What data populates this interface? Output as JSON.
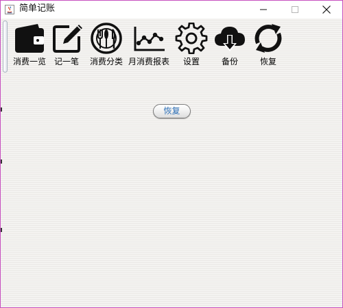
{
  "window": {
    "title": "简单记账",
    "controls": {
      "minimize": "minimize",
      "maximize": "maximize",
      "close": "close"
    }
  },
  "toolbar": {
    "items": [
      {
        "label": "消费一览",
        "icon": "wallet-icon"
      },
      {
        "label": "记一笔",
        "icon": "edit-icon"
      },
      {
        "label": "消费分类",
        "icon": "utensils-icon"
      },
      {
        "label": "月消费报表",
        "icon": "line-chart-icon"
      },
      {
        "label": "设置",
        "icon": "gear-icon"
      },
      {
        "label": "备份",
        "icon": "cloud-download-icon"
      },
      {
        "label": "恢复",
        "icon": "refresh-icon"
      }
    ]
  },
  "main": {
    "restore_button_label": "恢复"
  },
  "colors": {
    "window_border": "#c64fbf",
    "panel_background": "#f1f0ee",
    "button_text": "#2a6db5"
  }
}
